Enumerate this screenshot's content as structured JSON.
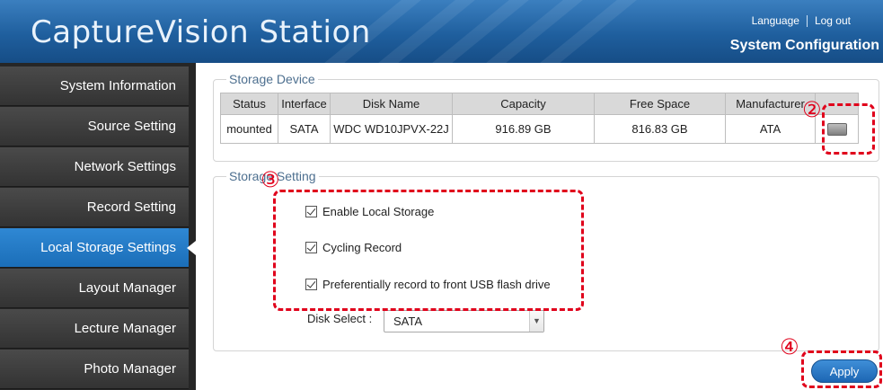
{
  "header": {
    "app_title": "CaptureVision Station",
    "language_link": "Language",
    "logout_link": "Log out",
    "page_heading": "System Configuration"
  },
  "sidebar": {
    "items": [
      {
        "label": "System Information"
      },
      {
        "label": "Source Setting"
      },
      {
        "label": "Network Settings"
      },
      {
        "label": "Record Setting"
      },
      {
        "label": "Local Storage Settings",
        "active": true
      },
      {
        "label": "Layout Manager"
      },
      {
        "label": "Lecture Manager"
      },
      {
        "label": "Photo Manager"
      }
    ]
  },
  "storage_device": {
    "legend": "Storage Device",
    "columns": [
      "Status",
      "Interface",
      "Disk Name",
      "Capacity",
      "Free Space",
      "Manufacturer"
    ],
    "rows": [
      {
        "status": "mounted",
        "interface": "SATA",
        "disk_name": "WDC WD10JPVX-22J",
        "capacity": "916.89 GB",
        "free_space": "816.83 GB",
        "manufacturer": "ATA",
        "icon": "hard-disk-icon"
      }
    ]
  },
  "storage_setting": {
    "legend": "Storage Setting",
    "options": [
      {
        "label": "Enable Local Storage",
        "checked": true
      },
      {
        "label": "Cycling Record",
        "checked": true
      },
      {
        "label": "Preferentially record to front USB flash drive",
        "checked": true
      }
    ],
    "disk_select_label": "Disk Select :",
    "disk_select_value": "SATA"
  },
  "actions": {
    "apply_label": "Apply"
  },
  "annotations": {
    "n2": "②",
    "n3": "③",
    "n4": "④",
    "color": "#e0001b"
  },
  "colors": {
    "header_blue": "#1f5f9e",
    "sidebar_active": "#2f88d4",
    "sidebar_bg": "#333333"
  }
}
